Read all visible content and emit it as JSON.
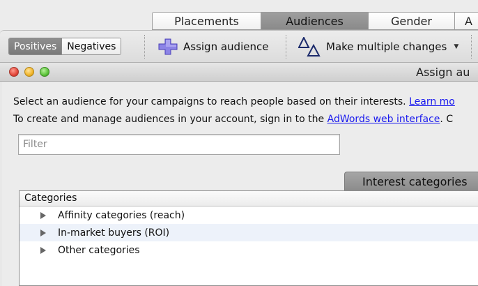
{
  "tabs": [
    {
      "label": "Placements",
      "active": false
    },
    {
      "label": "Audiences",
      "active": true
    },
    {
      "label": "Gender",
      "active": false
    },
    {
      "label": "A",
      "active": false
    }
  ],
  "toolbar": {
    "positives_label": "Positives",
    "negatives_label": "Negatives",
    "assign_label": "Assign audience",
    "multiple_label": "Make multiple changes",
    "dropdown_glyph": "▼"
  },
  "window": {
    "title": "Assign au"
  },
  "content": {
    "line1_text": "Select an audience for your campaigns to reach people based on their interests. ",
    "line1_link": "Learn mo",
    "line2_text": "To create and manage audiences in your account, sign in to the ",
    "line2_link": "AdWords web interface",
    "line2_tail": ". C",
    "filter_placeholder": "Filter",
    "section_tab": "Interest categories"
  },
  "categories": {
    "header": "Categories",
    "items": [
      {
        "label": "Affinity categories (reach)"
      },
      {
        "label": "In-market buyers (ROI)"
      },
      {
        "label": "Other categories"
      }
    ]
  },
  "colors": {
    "link": "#1a1aee",
    "selected_segment": "#8e8e8e",
    "row_alt": "#edf2fa",
    "assign_icon": "#7b6fd9"
  },
  "icons": {
    "assign": "plus-icon",
    "multiple": "delta-icon",
    "expand": "disclosure-triangle-icon"
  }
}
